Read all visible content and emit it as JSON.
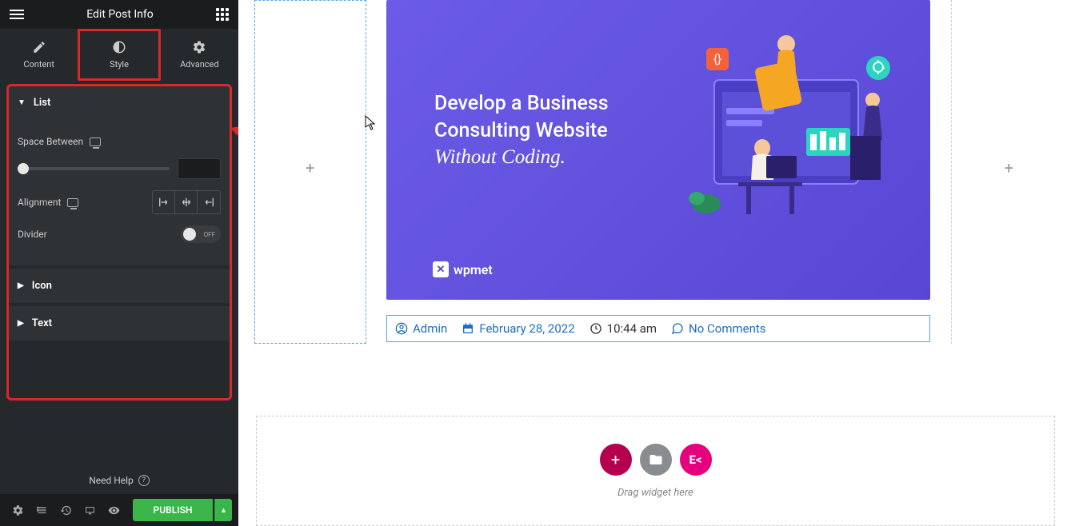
{
  "sidebar": {
    "title": "Edit Post Info",
    "tabs": [
      {
        "label": "Content"
      },
      {
        "label": "Style"
      },
      {
        "label": "Advanced"
      }
    ],
    "sections": {
      "list": {
        "title": "List",
        "space_between_label": "Space Between",
        "alignment_label": "Alignment",
        "divider_label": "Divider",
        "divider_state": "OFF"
      },
      "icon": {
        "title": "Icon"
      },
      "text": {
        "title": "Text"
      }
    },
    "need_help": "Need Help",
    "publish": "PUBLISH"
  },
  "hero": {
    "line1": "Develop a Business",
    "line2": "Consulting Website",
    "line3": "Without Coding.",
    "logo": "wpmet"
  },
  "post_meta": {
    "author": "Admin",
    "date": "February 28, 2022",
    "time": "10:44 am",
    "comments": "No Comments"
  },
  "drop_zone": {
    "text": "Drag widget here"
  }
}
